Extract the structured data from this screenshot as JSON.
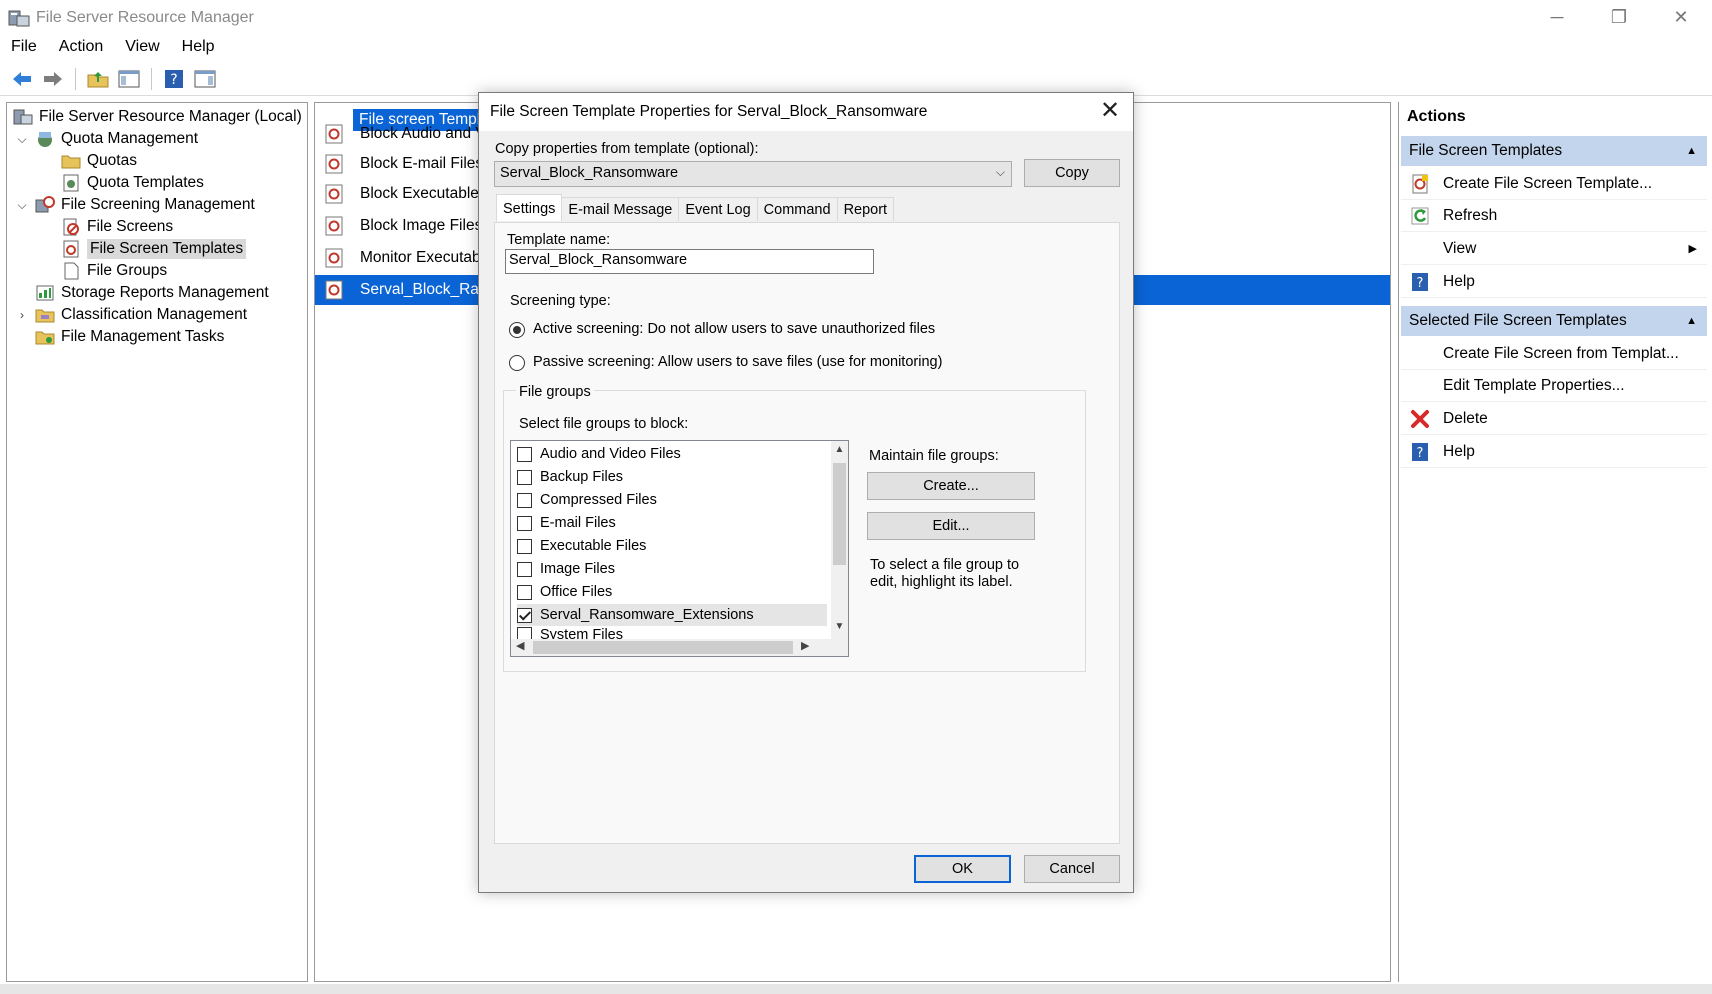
{
  "window": {
    "title": "File Server Resource Manager",
    "minimize": "─",
    "restore": "❐",
    "close": "✕"
  },
  "menu": [
    "File",
    "Action",
    "View",
    "Help"
  ],
  "tree": {
    "root": "File Server Resource Manager (Local)",
    "quota_management": "Quota Management",
    "quotas": "Quotas",
    "quota_templates": "Quota Templates",
    "file_screening_management": "File Screening Management",
    "file_screens": "File Screens",
    "file_screen_templates": "File Screen Templates",
    "file_groups": "File Groups",
    "storage_reports": "Storage Reports Management",
    "classification": "Classification Management",
    "file_management_tasks": "File Management Tasks"
  },
  "list": {
    "header": "File screen Templ",
    "rows": [
      "Block Audio and V",
      "Block E-mail Files",
      "Block Executable",
      "Block Image Files",
      "Monitor Executab",
      "Serval_Block_Rans"
    ]
  },
  "actions": {
    "title": "Actions",
    "section1": "File Screen Templates",
    "create_template": "Create File Screen Template...",
    "refresh": "Refresh",
    "view": "View",
    "help": "Help",
    "section2": "Selected File Screen Templates",
    "create_from_template": "Create File Screen from Templat...",
    "edit_props": "Edit Template Properties...",
    "delete": "Delete",
    "help2": "Help"
  },
  "dialog": {
    "title": "File Screen Template Properties for Serval_Block_Ransomware",
    "close": "✕",
    "copy_label": "Copy properties from template (optional):",
    "copy_value": "Serval_Block_Ransomware",
    "copy_button": "Copy",
    "tabs": [
      "Settings",
      "E-mail Message",
      "Event Log",
      "Command",
      "Report"
    ],
    "template_name_label": "Template name:",
    "template_name_value": "Serval_Block_Ransomware",
    "screening_type_label": "Screening type:",
    "active_screening": "Active screening: Do not allow users to save unauthorized files",
    "passive_screening": "Passive screening: Allow users to save files (use for monitoring)",
    "file_groups_label": "File groups",
    "select_groups_label": "Select file groups to block:",
    "file_groups": [
      {
        "label": "Audio and Video Files",
        "checked": false
      },
      {
        "label": "Backup Files",
        "checked": false
      },
      {
        "label": "Compressed Files",
        "checked": false
      },
      {
        "label": "E-mail Files",
        "checked": false
      },
      {
        "label": "Executable Files",
        "checked": false
      },
      {
        "label": "Image Files",
        "checked": false
      },
      {
        "label": "Office Files",
        "checked": false
      },
      {
        "label": "Serval_Ransomware_Extensions",
        "checked": true
      },
      {
        "label": "System Files",
        "checked": false
      }
    ],
    "maintain_label": "Maintain file groups:",
    "create_button": "Create...",
    "edit_button": "Edit...",
    "hint": "To select a file group to edit, highlight its label.",
    "ok": "OK",
    "cancel": "Cancel"
  },
  "colors": {
    "selection": "#0a64d6",
    "action_header": "#c2d5ec",
    "dialog_bg": "#f0f0f0"
  }
}
